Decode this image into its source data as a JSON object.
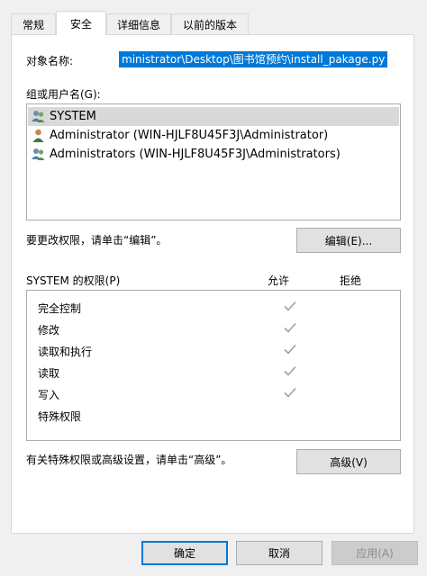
{
  "tabs": [
    {
      "label": "常规",
      "active": false
    },
    {
      "label": "安全",
      "active": true
    },
    {
      "label": "详细信息",
      "active": false
    },
    {
      "label": "以前的版本",
      "active": false
    }
  ],
  "object": {
    "label": "对象名称:",
    "value": "ministrator\\Desktop\\图书馆预约\\install_pakage.py"
  },
  "groups": {
    "label": "组或用户名(G):",
    "items": [
      {
        "name": "SYSTEM",
        "icon": "users-group-icon",
        "selected": true
      },
      {
        "name": "Administrator (WIN-HJLF8U45F3J\\Administrator)",
        "icon": "user-icon",
        "selected": false
      },
      {
        "name": "Administrators (WIN-HJLF8U45F3J\\Administrators)",
        "icon": "users-group-icon",
        "selected": false
      }
    ]
  },
  "edit": {
    "hint": "要更改权限，请单击“编辑”。",
    "button": "编辑(E)..."
  },
  "permissions": {
    "label": "SYSTEM 的权限(P)",
    "allow_header": "允许",
    "deny_header": "拒绝",
    "rows": [
      {
        "name": "完全控制",
        "allow": true,
        "deny": false
      },
      {
        "name": "修改",
        "allow": true,
        "deny": false
      },
      {
        "name": "读取和执行",
        "allow": true,
        "deny": false
      },
      {
        "name": "读取",
        "allow": true,
        "deny": false
      },
      {
        "name": "写入",
        "allow": true,
        "deny": false
      },
      {
        "name": "特殊权限",
        "allow": false,
        "deny": false
      }
    ]
  },
  "advanced": {
    "hint": "有关特殊权限或高级设置，请单击“高级”。",
    "button": "高级(V)"
  },
  "footer": {
    "ok": "确定",
    "cancel": "取消",
    "apply": "应用(A)"
  },
  "colors": {
    "selection": "#0078d7",
    "check": "#a0a0a0"
  }
}
